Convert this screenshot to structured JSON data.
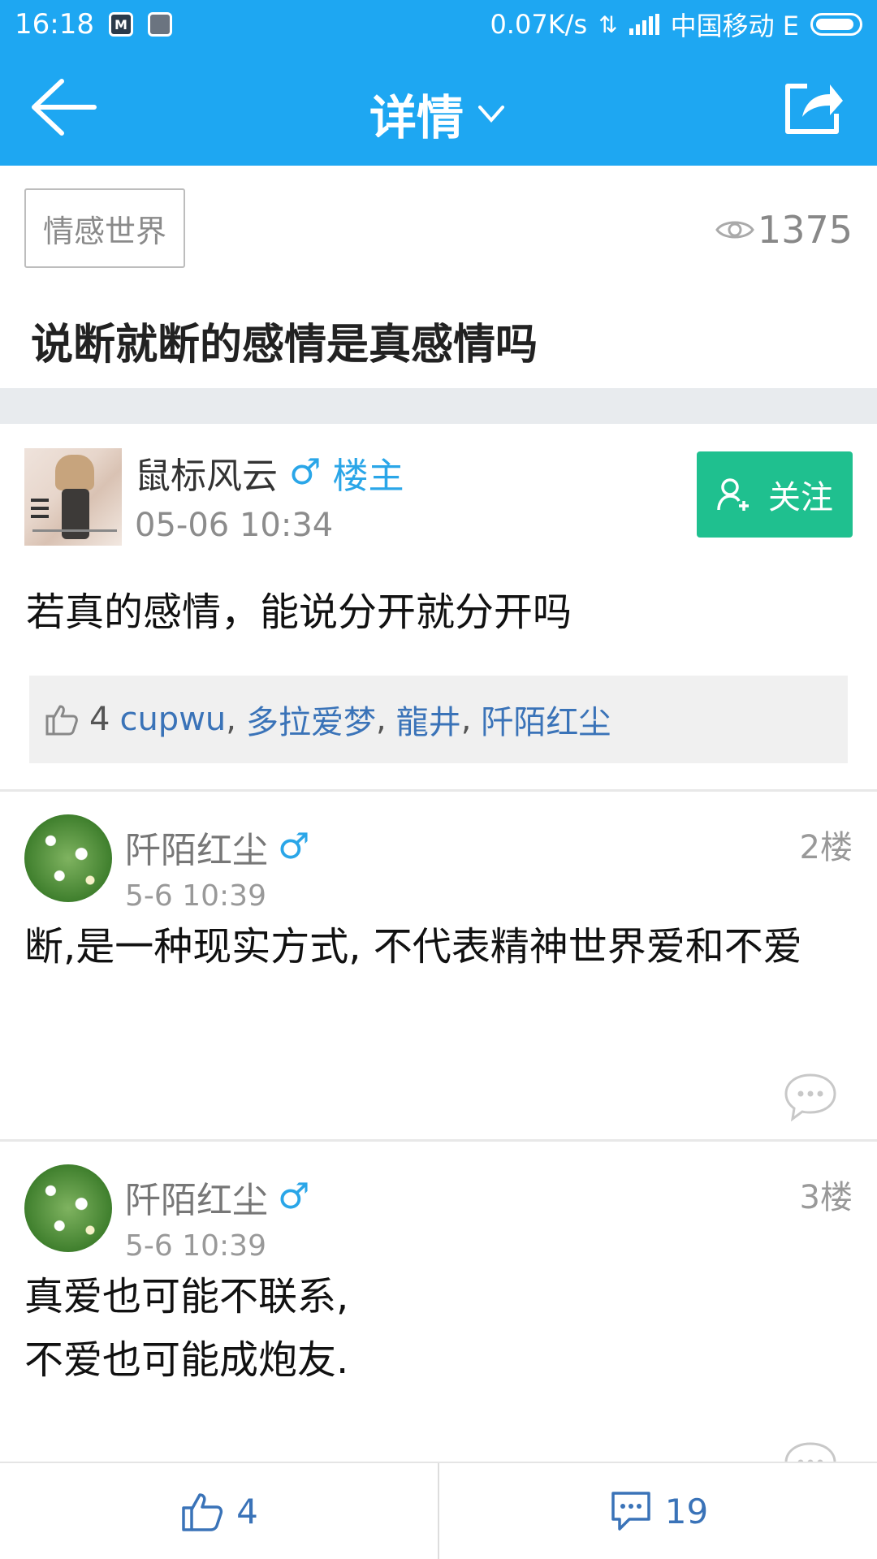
{
  "statusbar": {
    "time": "16:18",
    "speed": "0.07K/s",
    "carrier": "中国移动 E"
  },
  "navbar": {
    "title": "详情"
  },
  "header": {
    "category": "情感世界",
    "views": "1375",
    "title": "说断就断的感情是真感情吗"
  },
  "mainpost": {
    "author": "鼠标风云",
    "gender_symbol": "♂",
    "badge": "楼主",
    "time": "05-06 10:34",
    "follow_label": "关注",
    "content": "若真的感情，能说分开就分开吗",
    "likes": {
      "count": "4",
      "users": [
        "cupwu",
        "多拉爱梦",
        "龍井",
        "阡陌红尘"
      ]
    }
  },
  "replies": [
    {
      "author": "阡陌红尘",
      "gender_symbol": "♂",
      "time": "5-6 10:39",
      "floor": "2楼",
      "content": "断,是一种现实方式, 不代表精神世界爱和不爱"
    },
    {
      "author": "阡陌红尘",
      "gender_symbol": "♂",
      "time": "5-6 10:39",
      "floor": "3楼",
      "content_line1": "真爱也可能不联系,",
      "content_line2": "不爱也可能成炮友."
    }
  ],
  "bottombar": {
    "like_count": "4",
    "comment_count": "19"
  },
  "colors": {
    "brand_blue": "#1ea7f2",
    "follow_green": "#1fc08f",
    "link_blue": "#3a73b8",
    "gender_blue": "#2aa6e8"
  },
  "icons": [
    "back-arrow-icon",
    "chevron-down-icon",
    "share-icon",
    "eye-icon",
    "gender-male-icon",
    "add-user-icon",
    "thumbs-up-icon",
    "comment-bubble-icon"
  ]
}
